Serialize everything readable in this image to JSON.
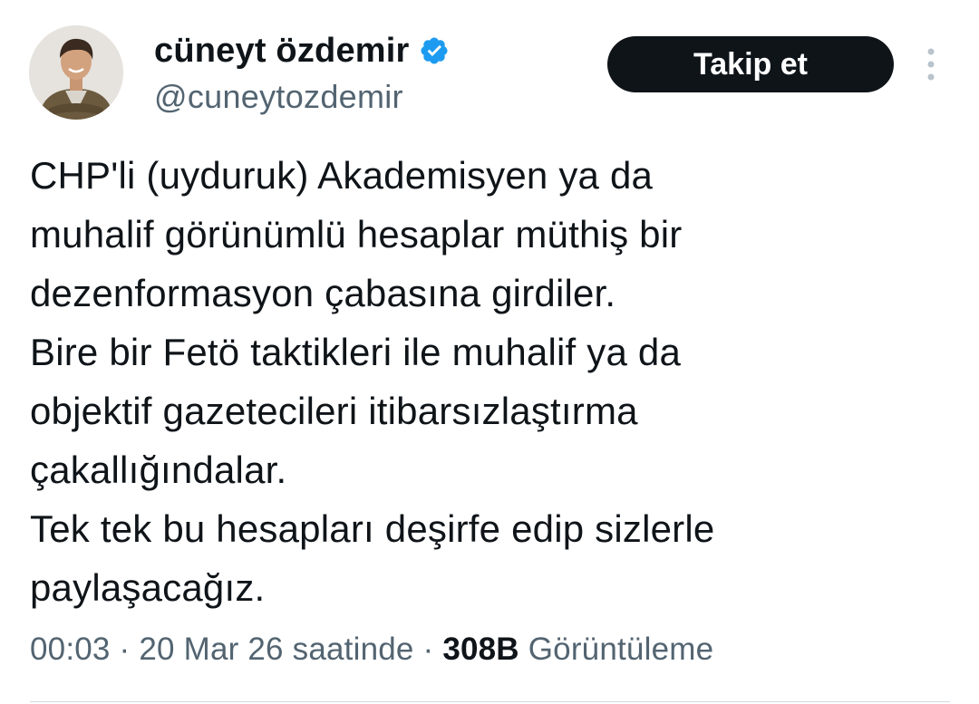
{
  "author": {
    "display_name": "cüneyt özdemir",
    "handle": "@cuneytozdemir",
    "verified": true,
    "verified_color": "#1d9bf0"
  },
  "actions": {
    "follow_label": "Takip et",
    "more_icon": "more-vertical-icon"
  },
  "tweet": {
    "text": "CHP'li (uyduruk) Akademisyen ya da\nmuhalif görünümlü hesaplar müthiş bir\ndezenformasyon çabasına girdiler.\nBire bir Fetö taktikleri ile muhalif ya da\nobjektif gazetecileri itibarsızlaştırma\nçakallığındalar.\nTek tek bu hesapları deşirfe edip sizlerle\npaylaşacağız."
  },
  "meta": {
    "time": "00:03",
    "separator": "·",
    "date": "20 Mar 26 saatinde",
    "views_count": "308B",
    "views_label": "Görüntüleme"
  },
  "colors": {
    "text_primary": "#0f1419",
    "text_secondary": "#536471",
    "button_bg": "#0f1419",
    "divider": "#cfd9de"
  }
}
